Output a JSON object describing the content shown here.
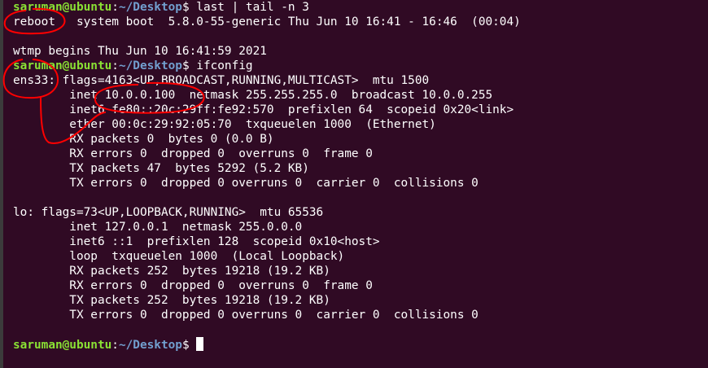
{
  "prompt": {
    "user_host": "saruman@ubuntu",
    "separator": ":",
    "path": "~/Desktop",
    "dollar": "$ "
  },
  "lines": [
    "last | tail -n 3",
    "reboot   system boot  5.8.0-55-generic Thu Jun 10 16:41 - 16:46  (00:04)",
    "",
    "wtmp begins Thu Jun 10 16:41:59 2021",
    "ifconfig",
    "ens33: flags=4163<UP,BROADCAST,RUNNING,MULTICAST>  mtu 1500",
    "        inet 10.0.0.100  netmask 255.255.255.0  broadcast 10.0.0.255",
    "        inet6 fe80::20c:29ff:fe92:570  prefixlen 64  scopeid 0x20<link>",
    "        ether 00:0c:29:92:05:70  txqueuelen 1000  (Ethernet)",
    "        RX packets 0  bytes 0 (0.0 B)",
    "        RX errors 0  dropped 0  overruns 0  frame 0",
    "        TX packets 47  bytes 5292 (5.2 KB)",
    "        TX errors 0  dropped 0 overruns 0  carrier 0  collisions 0",
    "",
    "lo: flags=73<UP,LOOPBACK,RUNNING>  mtu 65536",
    "        inet 127.0.0.1  netmask 255.0.0.0",
    "        inet6 ::1  prefixlen 128  scopeid 0x10<host>",
    "        loop  txqueuelen 1000  (Local Loopback)",
    "        RX packets 252  bytes 19218 (19.2 KB)",
    "        RX errors 0  dropped 0  overruns 0  frame 0",
    "        TX packets 252  bytes 19218 (19.2 KB)",
    "        TX errors 0  dropped 0 overruns 0  carrier 0  collisions 0"
  ],
  "colors": {
    "background": "#300a24",
    "user_host": "#8ae234",
    "path": "#729fcf",
    "text": "#ffffff",
    "annotation": "#ff0000"
  }
}
